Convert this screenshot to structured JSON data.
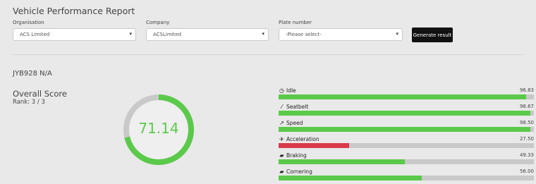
{
  "header": {
    "title": "Vehicle Performance Report"
  },
  "filters": {
    "organisation": {
      "label": "Organisation",
      "value": "ACS Limited"
    },
    "company": {
      "label": "Company",
      "value": "ACSLimited"
    },
    "plate": {
      "label": "Plate number",
      "value": "-Please select-"
    },
    "generate_label": "Generate result"
  },
  "vehicle": {
    "id": "JYB928 N/A"
  },
  "score": {
    "title": "Overall Score",
    "rank": "Rank: 3 / 3",
    "value": "71.14",
    "percent": 71.14
  },
  "colors": {
    "good": "#5bc94a",
    "bad": "#d93a4a",
    "track": "#c9c9c9"
  },
  "metrics": [
    {
      "icon": "clock-icon",
      "label": "Idle",
      "value": "96.83",
      "percent": 96.83,
      "status": "good"
    },
    {
      "icon": "seatbelt-icon",
      "label": "Seatbelt",
      "value": "98.67",
      "percent": 98.67,
      "status": "good"
    },
    {
      "icon": "chart-line-icon",
      "label": "Speed",
      "value": "98.50",
      "percent": 98.5,
      "status": "good"
    },
    {
      "icon": "plane-icon",
      "label": "Acceleration",
      "value": "27.50",
      "percent": 27.5,
      "status": "bad"
    },
    {
      "icon": "car-icon",
      "label": "Braking",
      "value": "49.33",
      "percent": 49.33,
      "status": "good"
    },
    {
      "icon": "car-icon",
      "label": "Cornering",
      "value": "56.00",
      "percent": 56,
      "status": "good"
    }
  ]
}
